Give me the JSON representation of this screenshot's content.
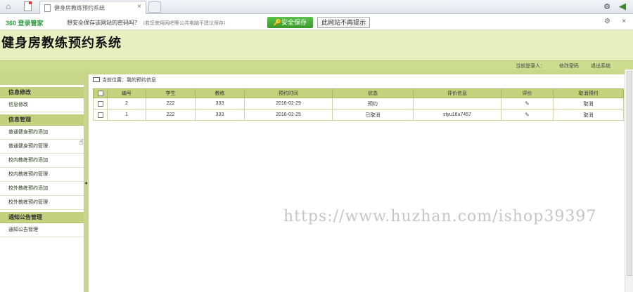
{
  "browser": {
    "tab_title": "健身房教练预约系统",
    "tab_close": "×"
  },
  "password_bar": {
    "brand": "360 登录管家",
    "message": "想安全保存该网站的密码吗？",
    "hint": "（若您使用网吧等公共电脑不建议保存）",
    "save_button": "安全保存",
    "never_button": "此网站不再提示",
    "close": "×"
  },
  "header": {
    "title": "健身房教练预约系统",
    "current_user_label": "当前登录人：",
    "change_password": "修改密码",
    "logout": "退出系统"
  },
  "sidebar": {
    "groups": [
      {
        "title": "信息修改",
        "items": [
          "信息修改"
        ]
      },
      {
        "title": "信息管理",
        "items": [
          "普通健身预约添加",
          "普通健身预约管理",
          "校内教练预约添加",
          "校内教练预约管理",
          "校外教练预约添加",
          "校外教练预约管理"
        ]
      },
      {
        "title": "通知公告管理",
        "items": [
          "通知公告管理"
        ]
      }
    ]
  },
  "main": {
    "breadcrumb": "当前位置：我的预约信息",
    "columns": [
      "编号",
      "学生",
      "教练",
      "预约时间",
      "状态",
      "评价信息",
      "评价",
      "取消预约"
    ],
    "rows": [
      {
        "id": "2",
        "student": "222",
        "coach": "333",
        "time": "2016-02-29",
        "status": "预约",
        "review": "",
        "cancel": "取消"
      },
      {
        "id": "1",
        "student": "222",
        "coach": "333",
        "time": "2016-02-25",
        "status": "已取消",
        "review": "styu16u7457",
        "cancel": "取消"
      }
    ]
  },
  "watermark": "https://www.huzhan.com/ishop39397",
  "colors": {
    "header_bg": "#e8efbf",
    "sidebar_head": "#c3d07e",
    "table_header": "#c4d27e",
    "save_green": "#3a9a2c"
  }
}
